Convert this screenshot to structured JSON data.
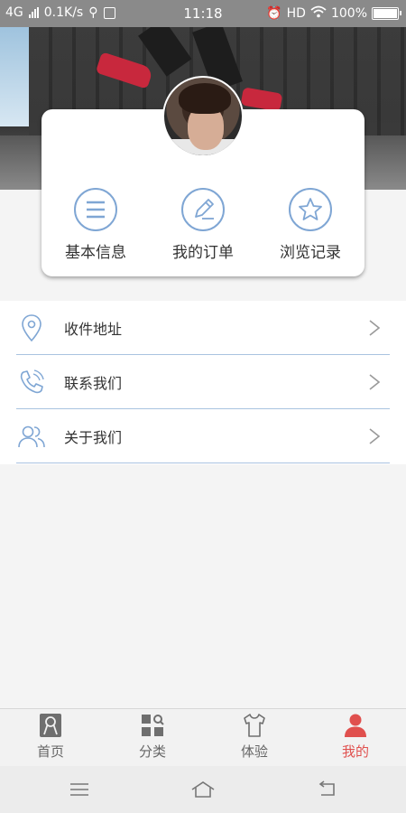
{
  "status_bar": {
    "network": "4G",
    "speed": "0.1K/s",
    "time": "11:18",
    "hd": "HD",
    "battery": "100%"
  },
  "profile": {
    "quick_actions": [
      {
        "label": "基本信息",
        "icon": "list-icon"
      },
      {
        "label": "我的订单",
        "icon": "pencil-icon"
      },
      {
        "label": "浏览记录",
        "icon": "star-icon"
      }
    ]
  },
  "menu": {
    "items": [
      {
        "label": "收件地址",
        "icon": "location-pin-icon"
      },
      {
        "label": "联系我们",
        "icon": "phone-icon"
      },
      {
        "label": "关于我们",
        "icon": "users-icon"
      }
    ]
  },
  "tabbar": {
    "tabs": [
      {
        "label": "首页",
        "icon": "home-ribbon-icon"
      },
      {
        "label": "分类",
        "icon": "category-icon"
      },
      {
        "label": "体验",
        "icon": "tshirt-icon"
      },
      {
        "label": "我的",
        "icon": "person-icon",
        "active": true
      }
    ]
  },
  "colors": {
    "accent_active": "#e0504e",
    "icon_blue": "#7fa6d4",
    "divider": "#a9c3e0"
  }
}
